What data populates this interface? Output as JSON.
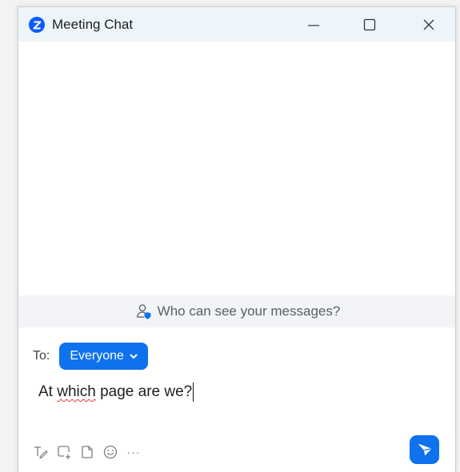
{
  "window": {
    "title": "Meeting Chat",
    "logo_icon": "zoom-logo-icon",
    "controls": [
      "minimize-icon",
      "maximize-icon",
      "close-icon"
    ]
  },
  "chat": {
    "visibility_text": "Who can see your messages?",
    "visibility_icon": "person-shield-icon"
  },
  "compose": {
    "to_label": "To:",
    "recipient": "Everyone",
    "message_before": "At ",
    "message_misspelled": "which",
    "message_after": " page are we?"
  },
  "toolbar": {
    "icons": [
      "format-icon",
      "screenshot-icon",
      "file-icon",
      "emoji-icon",
      "more-icon"
    ],
    "more_label": "···",
    "send_icon": "send-icon"
  },
  "colors": {
    "accent": "#0e72ed",
    "titlebar_bg": "#eef5fa",
    "visibility_bg": "#f2f4f7"
  }
}
